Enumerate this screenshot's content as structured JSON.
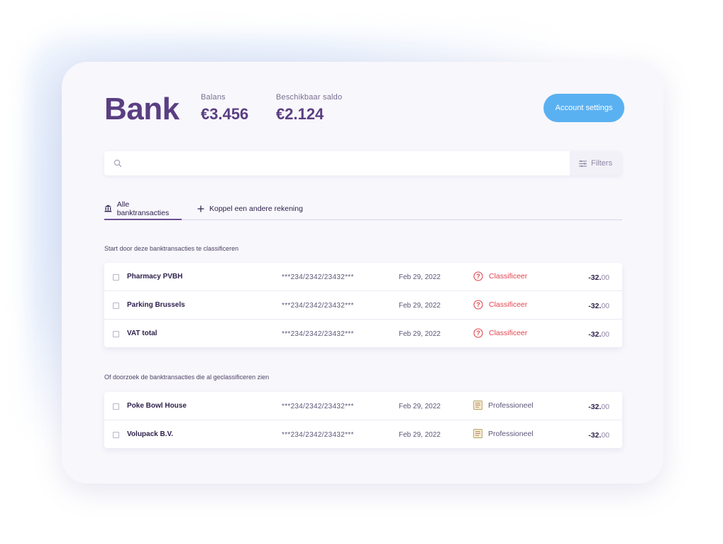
{
  "header": {
    "title": "Bank",
    "balance_label": "Balans",
    "balance_value": "€3.456",
    "available_label": "Beschikbaar saldo",
    "available_value": "€2.124",
    "account_settings_label": "Account settings"
  },
  "search": {
    "placeholder": "",
    "filters_label": "Filters"
  },
  "tabs": [
    {
      "label": "Alle banktransacties",
      "icon": "bank-icon",
      "active": true
    },
    {
      "label": "Koppel een andere rekening",
      "icon": "plus-icon",
      "active": false
    }
  ],
  "sections": [
    {
      "label": "Start door deze banktransacties te classificeren",
      "rows": [
        {
          "name": "Pharmacy PVBH",
          "account": "***234/2342/23432***",
          "date": "Feb 29, 2022",
          "status": "Classificeer",
          "status_icon": "question-circle-icon",
          "amount_int": "-32.",
          "amount_dec": "00"
        },
        {
          "name": "Parking Brussels",
          "account": "***234/2342/23432***",
          "date": "Feb 29, 2022",
          "status": "Classificeer",
          "status_icon": "question-circle-icon",
          "amount_int": "-32.",
          "amount_dec": "00"
        },
        {
          "name": "VAT total",
          "account": "***234/2342/23432***",
          "date": "Feb 29, 2022",
          "status": "Classificeer",
          "status_icon": "question-circle-icon",
          "amount_int": "-32.",
          "amount_dec": "00"
        }
      ]
    },
    {
      "label": "Of doorzoek de banktransacties die al geclassificeren  zien",
      "rows": [
        {
          "name": "Poke Bowl House",
          "account": "***234/2342/23432***",
          "date": "Feb 29, 2022",
          "status": "Professioneel",
          "status_icon": "briefcase-icon",
          "amount_int": "-32.",
          "amount_dec": "00"
        },
        {
          "name": "Volupack B.V.",
          "account": "***234/2342/23432***",
          "date": "Feb 29, 2022",
          "status": "Professioneel",
          "status_icon": "briefcase-icon",
          "amount_int": "-32.",
          "amount_dec": "00"
        }
      ]
    }
  ],
  "colors": {
    "brand_purple": "#5a3e82",
    "button_blue": "#5ab1f1",
    "classify_red": "#e0454f"
  }
}
